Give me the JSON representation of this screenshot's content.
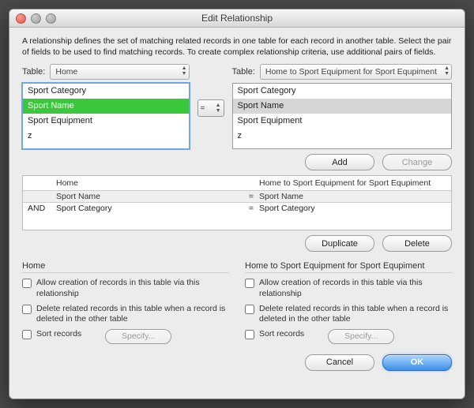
{
  "window": {
    "title": "Edit Relationship"
  },
  "description": "A relationship defines the set of matching related records in one table for each record in another table. Select the pair of fields to be used to find matching records. To create complex relationship criteria, use additional pairs of fields.",
  "left": {
    "tableLabel": "Table:",
    "tableValue": "Home",
    "fields": [
      "Sport Category",
      "Sport Name",
      "Sport Equipment",
      "z"
    ],
    "selectedIndex": 1
  },
  "right": {
    "tableLabel": "Table:",
    "tableValue": "Home to Sport Equipment for Sport Equpiment",
    "fields": [
      "Sport Category",
      "Sport Name",
      "Sport Equipment",
      "z"
    ],
    "selectedIndex": 1
  },
  "operator": "=",
  "buttons": {
    "add": "Add",
    "change": "Change",
    "duplicate": "Duplicate",
    "delete": "Delete",
    "cancel": "Cancel",
    "ok": "OK",
    "specify": "Specify..."
  },
  "pairs": {
    "headerLeft": "Home",
    "headerRight": "Home to Sport Equipment for Sport Equpiment",
    "rows": [
      {
        "and": "",
        "left": "Sport Name",
        "op": "=",
        "right": "Sport Name"
      },
      {
        "and": "AND",
        "left": "Sport Category",
        "op": "=",
        "right": "Sport Category"
      }
    ]
  },
  "options": {
    "leftTitle": "Home",
    "rightTitle": "Home to Sport Equipment for Sport Equpiment",
    "allowCreate": "Allow creation of records in this table via this relationship",
    "deleteRelated": "Delete related records in this table when a record is deleted in the other table",
    "sortRecords": "Sort records"
  }
}
